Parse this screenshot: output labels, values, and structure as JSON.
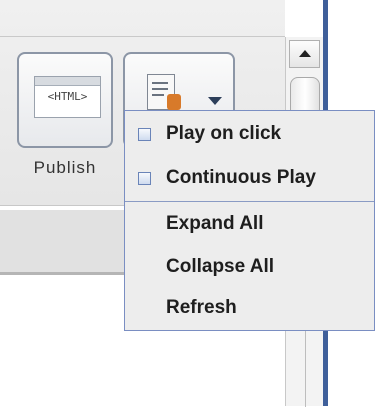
{
  "toolbar": {
    "publish_icon_text": "<HTML>",
    "publish_label": "Publish",
    "settings_icon": "doc-gear-icon",
    "dropdown_icon": "chevron-down-icon"
  },
  "popup_menu": {
    "items": [
      {
        "label": "Play on click",
        "checkbox": true,
        "checked": false
      },
      {
        "label": "Continuous Play",
        "checkbox": true,
        "checked": false
      },
      {
        "label": "Expand All",
        "checkbox": false
      },
      {
        "label": "Collapse All",
        "checkbox": false
      },
      {
        "label": "Refresh",
        "checkbox": false
      }
    ]
  },
  "colors": {
    "menu_border": "#7a8ec2",
    "window_border": "#3f5f9a",
    "menu_background": "#ededed"
  }
}
